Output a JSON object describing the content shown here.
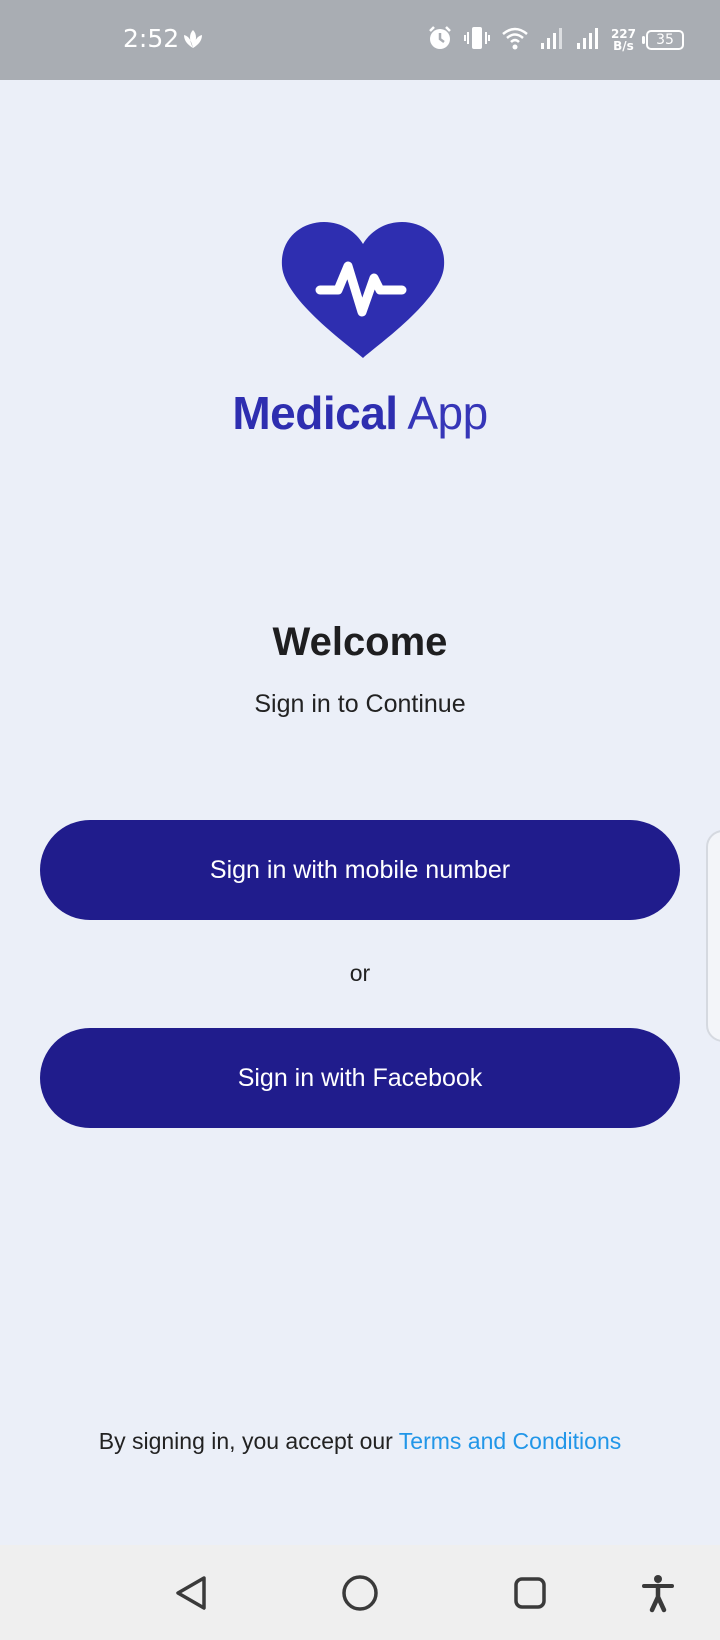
{
  "status_bar": {
    "time": "2:52",
    "net_speed_value": "227",
    "net_speed_unit": "B/s",
    "battery": "35",
    "icons": [
      "leaf-icon",
      "alarm-icon",
      "vibrate-icon",
      "wifi-icon",
      "signal-icon",
      "signal-icon",
      "battery-icon"
    ]
  },
  "logo": {
    "icon": "heart-pulse-icon",
    "name_bold": "Medical",
    "name_light": "App",
    "color": "#2e2eb0"
  },
  "welcome": {
    "title": "Welcome",
    "subtitle": "Sign in to Continue"
  },
  "buttons": {
    "mobile_label": "Sign in with mobile number",
    "or_label": "or",
    "facebook_label": "Sign in with Facebook",
    "color": "#201c8c"
  },
  "terms": {
    "prefix": "By signing in, you accept our",
    "link": "Terms and Conditions",
    "link_color": "#2196e8"
  },
  "nav_bar": {
    "icons": [
      "back-icon",
      "home-icon",
      "recents-icon",
      "accessibility-icon"
    ]
  }
}
